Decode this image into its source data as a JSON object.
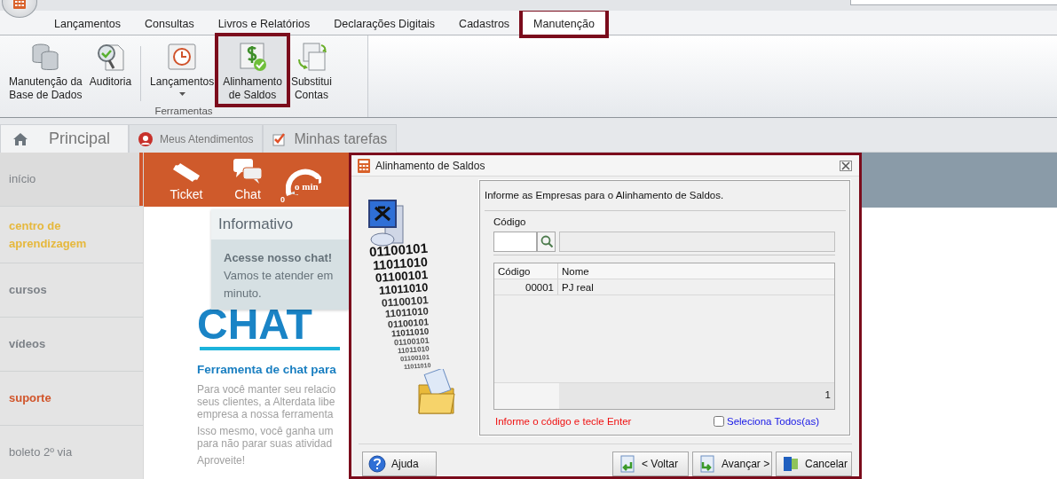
{
  "ribbon_tabs": [
    {
      "label": "Lançamentos",
      "selected": false,
      "highlighted": false
    },
    {
      "label": "Consultas",
      "selected": false,
      "highlighted": false
    },
    {
      "label": "Livros e Relatórios",
      "selected": false,
      "highlighted": false
    },
    {
      "label": "Declarações Digitais",
      "selected": false,
      "highlighted": false
    },
    {
      "label": "Cadastros",
      "selected": false,
      "highlighted": false
    },
    {
      "label": "Manutenção",
      "selected": true,
      "highlighted": true
    }
  ],
  "ribbon_buttons": [
    {
      "label": "Manutenção da\nBase de Dados",
      "dropdown": false,
      "pressed": false,
      "highlighted": false
    },
    {
      "label": "Auditoria",
      "dropdown": false,
      "pressed": false,
      "highlighted": false
    },
    {
      "label": "Lançamentos",
      "dropdown": true,
      "pressed": false,
      "highlighted": false
    },
    {
      "label": "Alinhamento\nde Saldos",
      "dropdown": false,
      "pressed": true,
      "highlighted": true
    },
    {
      "label": "Substitui\nContas",
      "dropdown": false,
      "pressed": false,
      "highlighted": false
    }
  ],
  "ribbon_group": "Ferramentas",
  "doc_tabs": [
    {
      "label": "Principal",
      "selected": true
    },
    {
      "label": "Meus Atendimentos",
      "selected": false
    },
    {
      "label": "Minhas tarefas",
      "selected": false
    }
  ],
  "sidebar": {
    "items": [
      {
        "label": "início",
        "selected": true,
        "bold": false,
        "color": "#7f8388"
      },
      {
        "label": "centro de aprendizagem",
        "selected": false,
        "bold": true,
        "color": "#e6b83c"
      },
      {
        "label": "cursos",
        "selected": false,
        "bold": true,
        "color": "#7d8288"
      },
      {
        "label": "vídeos",
        "selected": false,
        "bold": true,
        "color": "#7d8288"
      },
      {
        "label": "suporte",
        "selected": false,
        "bold": true,
        "color": "#d1552b"
      },
      {
        "label": "boleto 2º via",
        "selected": false,
        "bold": false,
        "color": "#7f8388"
      }
    ]
  },
  "web_header": {
    "items": [
      {
        "label": "Ticket"
      },
      {
        "label": "Chat"
      }
    ],
    "gauge": {
      "value": "0",
      "label": "o min"
    }
  },
  "popover": {
    "title": "Informativo",
    "heading": "Acesse nosso chat!",
    "lines": [
      "Vamos te atender em",
      "minuto."
    ]
  },
  "article": {
    "title": "CHAT",
    "heading": "Ferramenta de chat para",
    "paragraphs": [
      [
        "Para você manter seu relacio",
        "seus clientes, a Alterdata libe",
        "empresa a nossa ferramenta"
      ],
      [
        "Isso mesmo, você ganha um",
        "para não parar suas atividad"
      ],
      [
        "Aproveite!"
      ]
    ]
  },
  "dialog": {
    "title": "Alinhamento de Saldos",
    "highlighted": true,
    "art_lines": [
      "01100101",
      "11011010",
      "01100101",
      "11011010",
      "01100101",
      "11011010",
      "01100101",
      "11011010",
      "01100101",
      "11011010",
      "01100101",
      "11011010"
    ],
    "instruction": "Informe as Empresas para o Alinhamento de Saldos.",
    "code_label": "Código",
    "grid": {
      "columns": [
        "Código",
        "Nome"
      ],
      "rows": [
        [
          "00001",
          "PJ real"
        ]
      ],
      "footer_count": "1"
    },
    "hint": "Informe o código e tecle Enter",
    "select_all": {
      "label": "Seleciona Todos(as)",
      "checked": false
    },
    "buttons": [
      {
        "label": "Ajuda"
      },
      {
        "label": "< Voltar"
      },
      {
        "label": "Avançar >"
      },
      {
        "label": "Cancelar"
      }
    ]
  }
}
